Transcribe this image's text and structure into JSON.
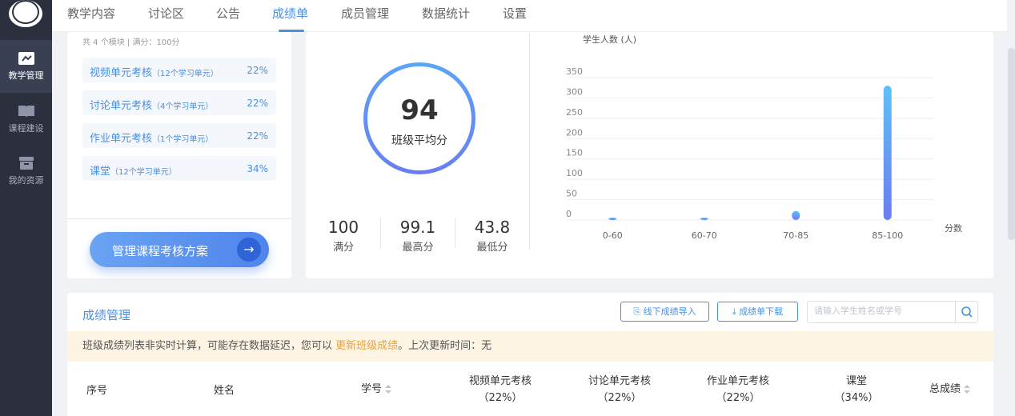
{
  "nav": {
    "items": [
      {
        "label": "教学管理",
        "icon": "teaching-icon"
      },
      {
        "label": "课程建设",
        "icon": "book-icon"
      },
      {
        "label": "我的资源",
        "icon": "box-icon"
      }
    ]
  },
  "tabs": [
    {
      "label": "教学内容"
    },
    {
      "label": "讨论区"
    },
    {
      "label": "公告"
    },
    {
      "label": "成绩单"
    },
    {
      "label": "成员管理"
    },
    {
      "label": "数据统计"
    },
    {
      "label": "设置"
    }
  ],
  "modules": {
    "header": "共 4 个模块 | 满分：100分",
    "items": [
      {
        "name": "视频单元考核",
        "sub": "（12个学习单元）",
        "pct": "22%"
      },
      {
        "name": "讨论单元考核",
        "sub": "（4个学习单元）",
        "pct": "22%"
      },
      {
        "name": "作业单元考核",
        "sub": "（1个学习单元）",
        "pct": "22%"
      },
      {
        "name": "课堂",
        "sub": "（12个学习单元）",
        "pct": "34%"
      }
    ],
    "manage_button": "管理课程考核方案"
  },
  "summary": {
    "average": "94",
    "average_label": "班级平均分",
    "stats": [
      {
        "value": "100",
        "label": "满分"
      },
      {
        "value": "99.1",
        "label": "最高分"
      },
      {
        "value": "43.8",
        "label": "最低分"
      }
    ]
  },
  "chart_data": {
    "type": "bar",
    "ylabel": "学生人数 (人)",
    "xlabel": "分数",
    "categories": [
      "0-60",
      "60-70",
      "70-85",
      "85-100"
    ],
    "values": [
      2,
      2,
      22,
      330
    ],
    "ylim": [
      0,
      350
    ],
    "yticks": [
      "0",
      "50",
      "100",
      "150",
      "200",
      "250",
      "300",
      "350"
    ],
    "colors": {
      "top": "#5ec1f7",
      "bottom": "#6b7cf0"
    }
  },
  "grades": {
    "title": "成绩管理",
    "import_button": "线下成绩导入",
    "download_button": "成绩单下载",
    "search_placeholder": "请输入学生姓名或学号",
    "notice_pre": "班级成绩列表非实时计算，可能存在数据延迟，您可以 ",
    "notice_link": "更新班级成绩",
    "notice_post": "。上次更新时间：无",
    "columns": {
      "index": "序号",
      "name": "姓名",
      "student_id": "学号",
      "video": "视频单元考核",
      "video_pct": "（22%）",
      "discussion": "讨论单元考核",
      "discussion_pct": "（22%）",
      "homework": "作业单元考核",
      "homework_pct": "（22%）",
      "classroom": "课堂",
      "classroom_pct": "（34%）",
      "total": "总成绩"
    }
  }
}
